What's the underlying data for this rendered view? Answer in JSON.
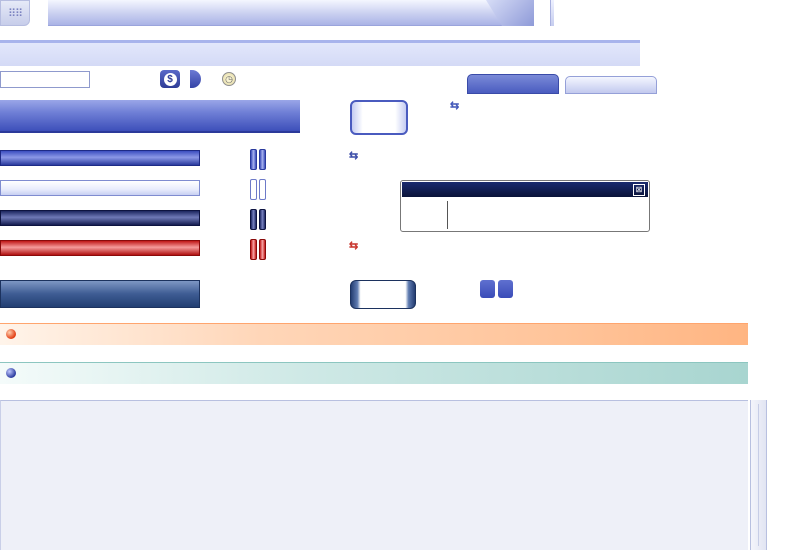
{
  "window": {
    "title": "",
    "menu_icon": "grid-menu-icon"
  },
  "toolbar": {
    "text_field_value": "",
    "currency_icon": "dollar-icon",
    "currency_symbol": "$",
    "clock_icon": "clock-icon",
    "clock_symbol": "◷"
  },
  "tabs": [
    {
      "label": "",
      "active": true
    },
    {
      "label": "",
      "active": false
    }
  ],
  "mini_window": {
    "title": "",
    "close_symbol": "⊠"
  },
  "icons": {
    "swap": "⇆"
  },
  "colors": {
    "accent_blue": "#3d4fba",
    "navy": "#1c2660",
    "red": "#c01818",
    "orange_strip": "#ffc49a",
    "teal_strip": "#a8d5d0"
  }
}
